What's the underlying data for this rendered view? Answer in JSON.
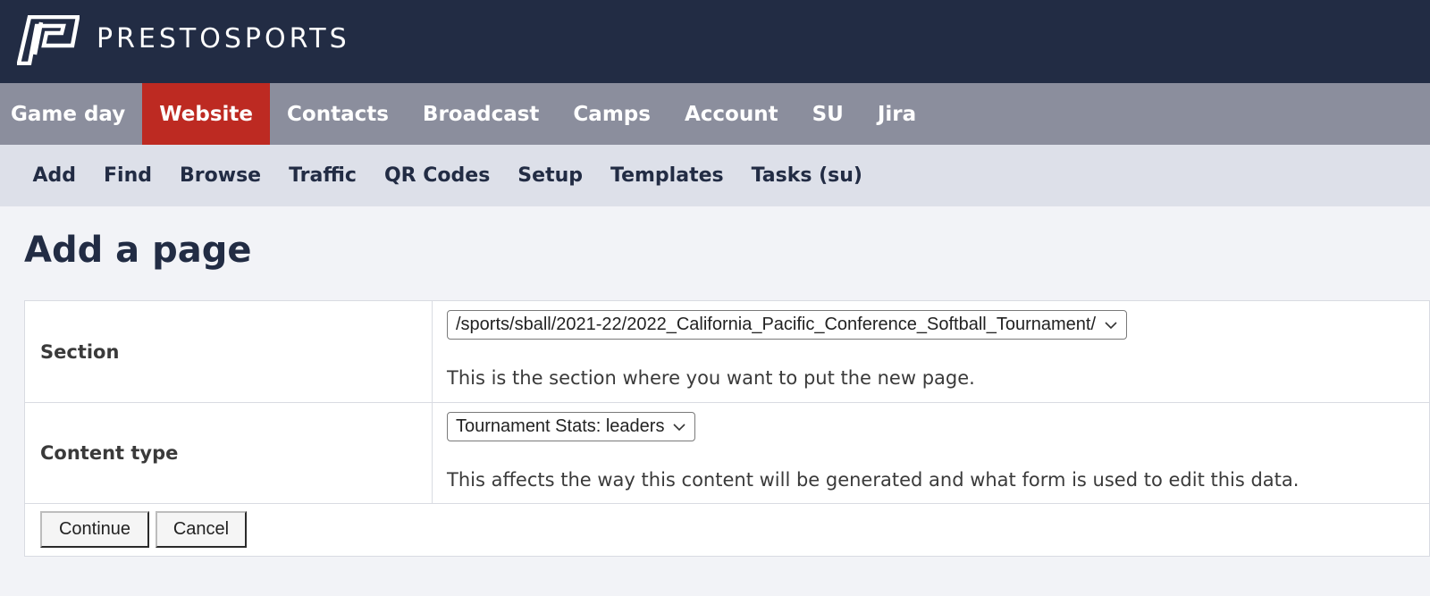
{
  "brand": {
    "name": "PRESTOSPORTS",
    "logo_icon": "prestosports-logo-icon"
  },
  "main_nav": [
    {
      "label": "Game day",
      "active": false
    },
    {
      "label": "Website",
      "active": true
    },
    {
      "label": "Contacts",
      "active": false
    },
    {
      "label": "Broadcast",
      "active": false
    },
    {
      "label": "Camps",
      "active": false
    },
    {
      "label": "Account",
      "active": false
    },
    {
      "label": "SU",
      "active": false
    },
    {
      "label": "Jira",
      "active": false
    }
  ],
  "sub_nav": [
    "Add",
    "Find",
    "Browse",
    "Traffic",
    "QR Codes",
    "Setup",
    "Templates",
    "Tasks (su)"
  ],
  "page": {
    "title": "Add a page"
  },
  "form": {
    "section": {
      "label": "Section",
      "selected": "/sports/sball/2021-22/2022_California_Pacific_Conference_Softball_Tournament/",
      "help": "This is the section where you want to put the new page."
    },
    "content_type": {
      "label": "Content type",
      "selected": "Tournament Stats: leaders",
      "help": "This affects the way this content will be generated and what form is used to edit this data."
    },
    "buttons": {
      "continue": "Continue",
      "cancel": "Cancel"
    }
  },
  "colors": {
    "brand_bar": "#222c44",
    "main_nav": "#8b8e9d",
    "active_tab": "#bd2a22",
    "sub_nav": "#dde0e9"
  }
}
